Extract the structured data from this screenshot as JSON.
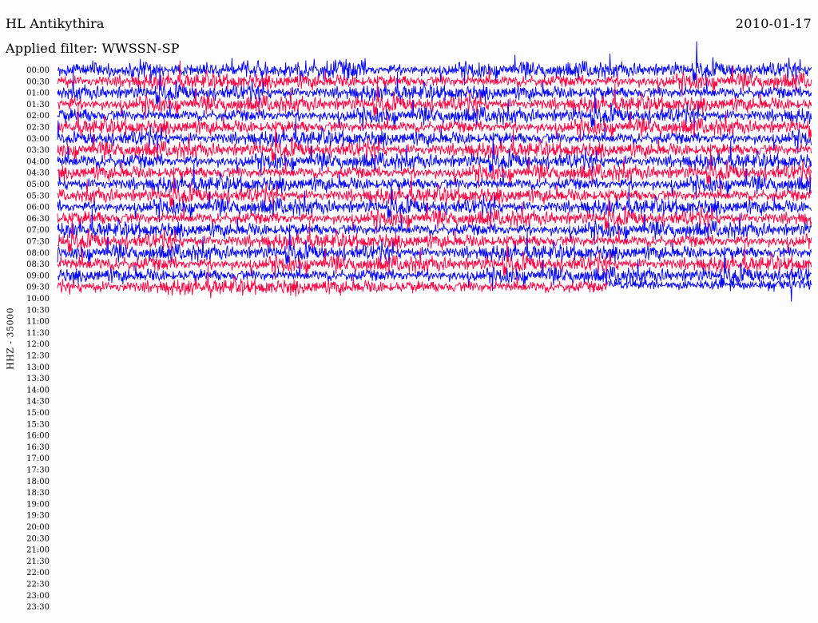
{
  "header": {
    "station": "HL Antikythira",
    "date": "2010-01-17",
    "filter": "Applied filter: WWSSN-SP"
  },
  "channel_label": "HHZ - 35000",
  "colors": {
    "trace_a": "#0000ff",
    "trace_b": "#ff0040",
    "background": "#fdfdfd"
  },
  "chart_data": {
    "type": "line",
    "title": "",
    "xlabel": "",
    "ylabel": "HHZ - 35000",
    "row_interval_minutes": 30,
    "rows": [
      "00:00",
      "00:30",
      "01:00",
      "01:30",
      "02:00",
      "02:30",
      "03:00",
      "03:30",
      "04:00",
      "04:30",
      "05:00",
      "05:30",
      "06:00",
      "06:30",
      "07:00",
      "07:30",
      "08:00",
      "08:30",
      "09:00",
      "09:30",
      "10:00",
      "10:30",
      "11:00",
      "11:30",
      "12:00",
      "12:30",
      "13:00",
      "13:30",
      "14:00",
      "14:30",
      "15:00",
      "15:30",
      "16:00",
      "16:30",
      "17:00",
      "17:30",
      "18:00",
      "18:30",
      "19:00",
      "19:30",
      "20:00",
      "20:30",
      "21:00",
      "21:30",
      "22:00",
      "22:30",
      "23:00",
      "23:30"
    ],
    "trace_colors_alternate": [
      "#0000ff",
      "#ff0040"
    ],
    "recorded_rows": 20,
    "last_row_fraction_recorded": 0.73,
    "grid": false,
    "legend": "none"
  }
}
